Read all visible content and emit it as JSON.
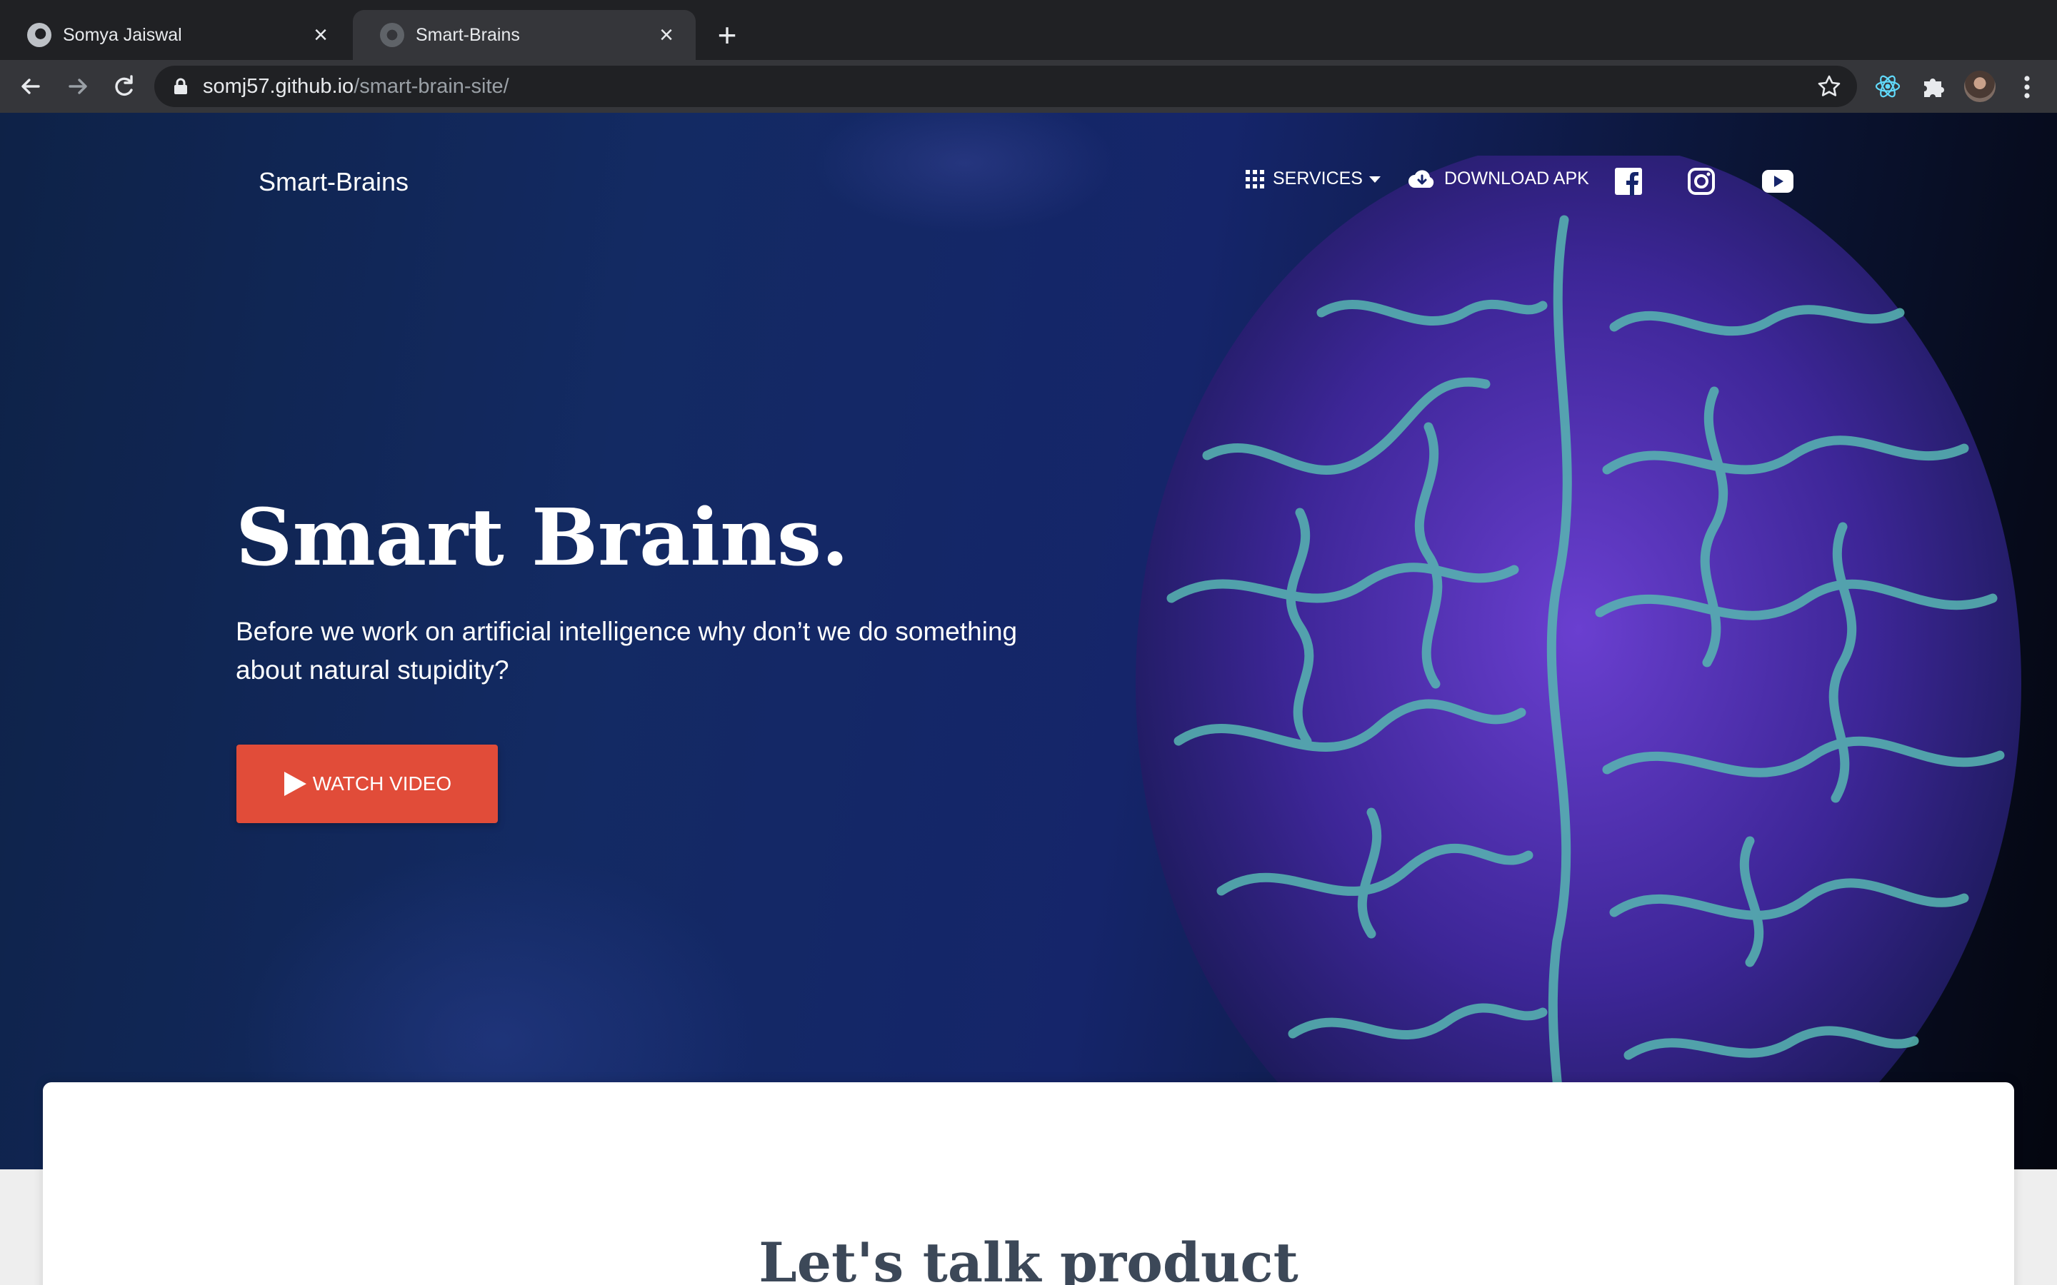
{
  "browser": {
    "tabs": [
      {
        "title": "Somya Jaiswal",
        "active": false
      },
      {
        "title": "Smart-Brains",
        "active": true
      }
    ],
    "close_glyph": "×",
    "new_tab_glyph": "+",
    "url_host": "somj57.github.io",
    "url_path": "/smart-brain-site/",
    "icons": [
      "back-icon",
      "forward-icon",
      "reload-icon",
      "lock-icon",
      "star-icon",
      "react-extension-icon",
      "puzzle-extension-icon",
      "profile-avatar",
      "menu-dots-icon"
    ]
  },
  "site": {
    "brand": "Smart-Brains",
    "nav": {
      "services_label": "SERVICES",
      "download_label": "DOWNLOAD APK"
    },
    "social_icons": [
      "facebook-icon",
      "instagram-icon",
      "youtube-icon"
    ],
    "hero": {
      "title": "Smart Brains.",
      "text": "Before we work on artificial intelligence why don’t we do something about natural stupidity?",
      "button_label": "WATCH VIDEO"
    },
    "section_title": "Let's talk product"
  },
  "colors": {
    "chrome_dark": "#202124",
    "chrome_toolbar": "#35363a",
    "accent_button": "#e14c39",
    "hero_bg": "#132a63",
    "brain_glow": "#4fb8b0",
    "brain_fill": "#5a2fb8",
    "section_title": "#3c4858"
  }
}
